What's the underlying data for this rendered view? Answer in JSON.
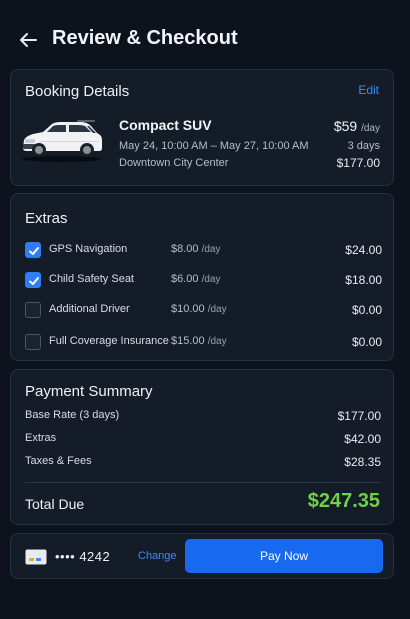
{
  "header": {
    "title": "Review & Checkout"
  },
  "booking": {
    "title": "Booking Details",
    "edit_label": "Edit",
    "vehicle": "Compact SUV",
    "dates": "May 24, 10:00 AM – May 27, 10:00 AM",
    "location": "Downtown City Center",
    "rate": "$59",
    "rate_unit": "/day",
    "days": "3 days",
    "total": "$177.00"
  },
  "extras": {
    "title": "Extras",
    "items": [
      {
        "name": "GPS Navigation",
        "rate": "$8.00",
        "unit": "/day",
        "price": "$24.00",
        "checked": true
      },
      {
        "name": "Child Safety Seat",
        "rate": "$6.00",
        "unit": "/day",
        "price": "$18.00",
        "checked": true
      },
      {
        "name": "Additional Driver",
        "rate": "$10.00",
        "unit": "/day",
        "price": "$0.00",
        "checked": false
      },
      {
        "name": "Full Coverage Insurance",
        "rate": "$15.00",
        "unit": "/day",
        "price": "$0.00",
        "checked": false
      }
    ]
  },
  "summary": {
    "title": "Payment Summary",
    "rows": [
      {
        "label": "Base Rate (3 days)",
        "value": "$177.00"
      },
      {
        "label": "Extras",
        "value": "$42.00"
      },
      {
        "label": "Taxes & Fees",
        "value": "$28.35"
      }
    ],
    "total_label": "Total Due",
    "total_value": "$247.35"
  },
  "payment": {
    "card_icon": "credit-card-icon",
    "card_mask": "•••• 4242",
    "change_label": "Change",
    "pay_label": "Pay Now"
  },
  "colors": {
    "background": "#0d131d",
    "card": "#141c28",
    "accent": "#1769f0",
    "link": "#3b8df5",
    "total": "#6fd14a"
  }
}
